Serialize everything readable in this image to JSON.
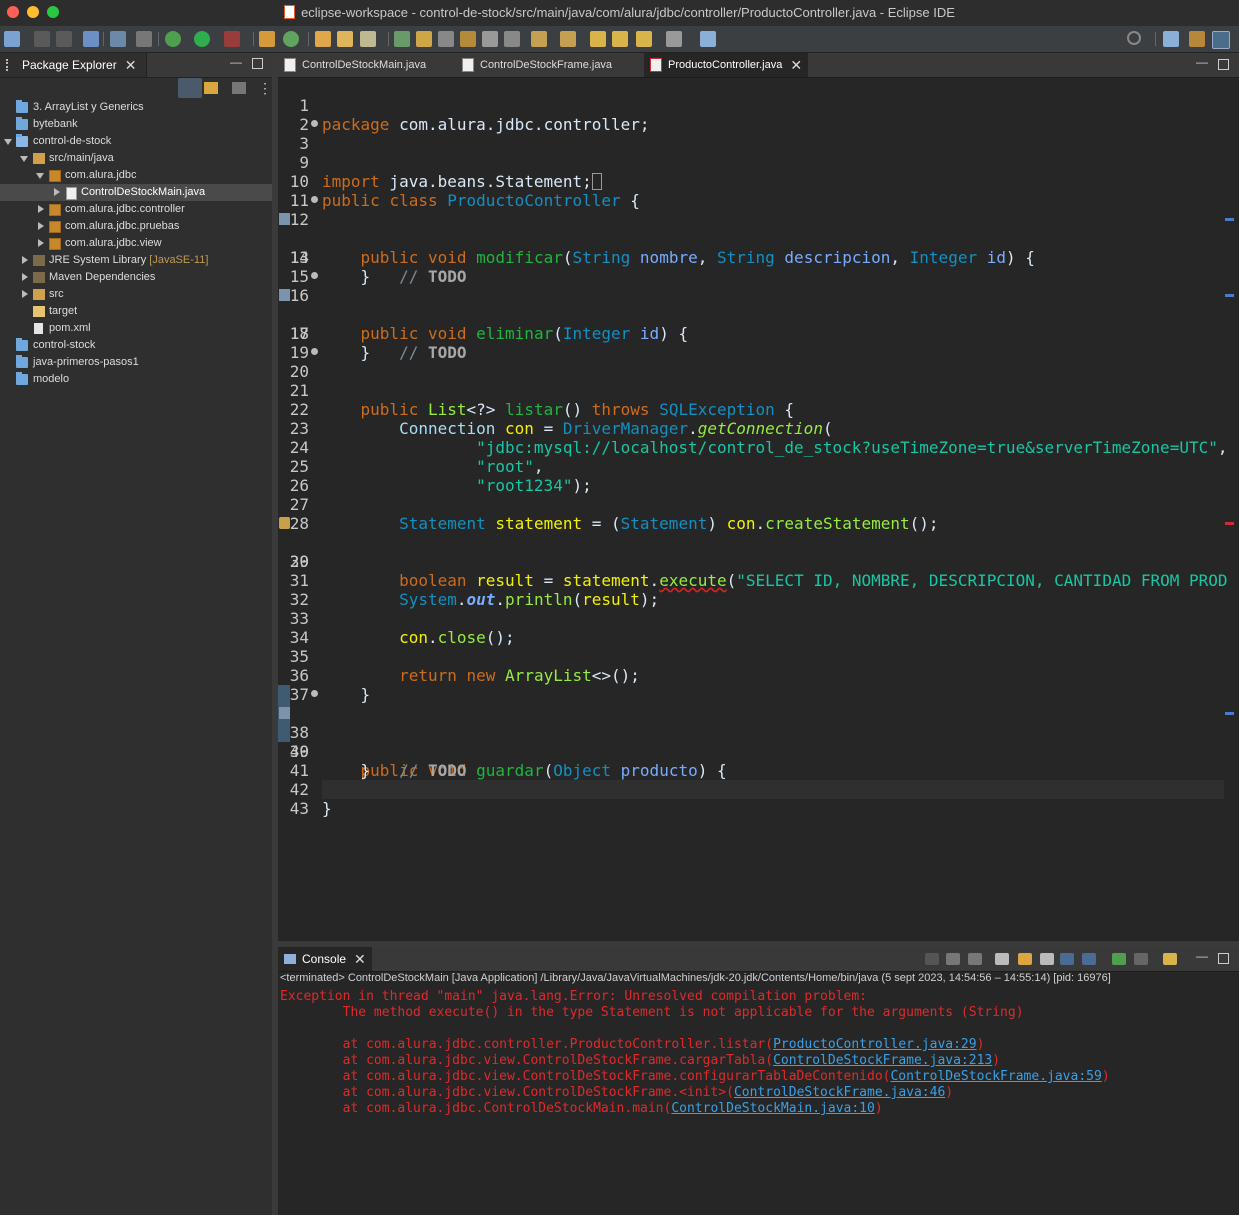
{
  "window": {
    "title": "eclipse-workspace - control-de-stock/src/main/java/com/alura/jdbc/controller/ProductoController.java - Eclipse IDE"
  },
  "package_explorer": {
    "tab_label": "Package Explorer",
    "items": [
      {
        "label": "3. ArrayList y Generics"
      },
      {
        "label": "bytebank"
      },
      {
        "label": "control-de-stock"
      },
      {
        "label": "src/main/java"
      },
      {
        "label": "com.alura.jdbc"
      },
      {
        "label": "ControlDeStockMain.java"
      },
      {
        "label": "com.alura.jdbc.controller"
      },
      {
        "label": "com.alura.jdbc.pruebas"
      },
      {
        "label": "com.alura.jdbc.view"
      },
      {
        "label": "JRE System Library",
        "suffix": "[JavaSE-11]"
      },
      {
        "label": "Maven Dependencies"
      },
      {
        "label": "src"
      },
      {
        "label": "target"
      },
      {
        "label": "pom.xml"
      },
      {
        "label": "control-stock"
      },
      {
        "label": "java-primeros-pasos1"
      },
      {
        "label": "modelo"
      }
    ]
  },
  "editor": {
    "tabs": [
      {
        "label": "ControlDeStockMain.java"
      },
      {
        "label": "ControlDeStockFrame.java"
      },
      {
        "label": "ProductoController.java"
      }
    ],
    "line_numbers": [
      "1",
      "2",
      "3",
      "9",
      "10",
      "11",
      "12",
      "13",
      "14",
      "15",
      "16",
      "17",
      "18",
      "19",
      "20",
      "21",
      "22",
      "23",
      "24",
      "25",
      "26",
      "27",
      "28",
      "29",
      "30",
      "31",
      "32",
      "33",
      "34",
      "35",
      "36",
      "37",
      "38",
      "39",
      "40",
      "41",
      "42",
      "43"
    ],
    "code": {
      "l1": [
        "package",
        " com.alura.jdbc.controller;"
      ],
      "l3": [
        "import",
        " java.beans.Statement;"
      ],
      "l10": [
        "public",
        "class",
        "ProductoController",
        " {"
      ],
      "l12": [
        "public",
        "void",
        "modificar",
        "(",
        "String",
        "nombre",
        ", ",
        "String",
        "descripcion",
        ", ",
        "Integer",
        "id",
        ") {"
      ],
      "l13": [
        "// ",
        "TODO"
      ],
      "l14": [
        "}"
      ],
      "l16": [
        "public",
        "void",
        "eliminar",
        "(",
        "Integer",
        "id",
        ") {"
      ],
      "l17": [
        "// ",
        "TODO"
      ],
      "l18": [
        "}"
      ],
      "l20": [
        "public",
        "List",
        "<?>",
        "listar",
        "() ",
        "throws",
        "SQLException",
        " {"
      ],
      "l22": [
        "Connection",
        "con",
        " = ",
        "DriverManager",
        ".",
        "getConnection",
        "("
      ],
      "l23": [
        "\"jdbc:mysql://localhost/control_de_stock?useTimeZone=true&serverTimeZone=UTC\"",
        ","
      ],
      "l24": [
        "\"root\"",
        ","
      ],
      "l25": [
        "\"root1234\"",
        ");"
      ],
      "l27": [
        "Statement",
        "statement",
        " = (",
        "Statement",
        ") ",
        "con",
        ".",
        "createStatement",
        "();"
      ],
      "l29": [
        "boolean",
        "result",
        " = ",
        "statement",
        ".",
        "execute",
        "(",
        "\"SELECT ID, NOMBRE, DESCRIPCION, CANTIDAD FROM PROD"
      ],
      "l31": [
        "System",
        ".",
        "out",
        ".",
        "println",
        "(",
        "result",
        ");"
      ],
      "l33": [
        "con",
        ".",
        "close",
        "();"
      ],
      "l35": [
        "return",
        "new",
        "ArrayList",
        "<>();"
      ],
      "l36": [
        "}"
      ],
      "l38": [
        "public",
        "void",
        "guardar",
        "(",
        "Object",
        "producto",
        ") {"
      ],
      "l39": [
        "// ",
        "TODO"
      ],
      "l40": [
        "}"
      ],
      "l42": [
        "}"
      ]
    }
  },
  "console": {
    "tab_label": "Console",
    "info": "<terminated> ControlDeStockMain [Java Application] /Library/Java/JavaVirtualMachines/jdk-20.jdk/Contents/Home/bin/java  (5 sept 2023, 14:54:56 – 14:55:14) [pid: 16976]",
    "lines": [
      {
        "text": "Exception in thread \"main\" java.lang.Error: Unresolved compilation problem: "
      },
      {
        "text": "\tThe method execute() in the type Statement is not applicable for the arguments (String)"
      },
      {
        "text": ""
      },
      {
        "text": "\tat com.alura.jdbc.controller.ProductoController.listar(",
        "link": "ProductoController.java:29",
        "end": ")"
      },
      {
        "text": "\tat com.alura.jdbc.view.ControlDeStockFrame.cargarTabla(",
        "link": "ControlDeStockFrame.java:213",
        "end": ")"
      },
      {
        "text": "\tat com.alura.jdbc.view.ControlDeStockFrame.configurarTablaDeContenido(",
        "link": "ControlDeStockFrame.java:59",
        "end": ")"
      },
      {
        "text": "\tat com.alura.jdbc.view.ControlDeStockFrame.<init>(",
        "link": "ControlDeStockFrame.java:46",
        "end": ")"
      },
      {
        "text": "\tat com.alura.jdbc.ControlDeStockMain.main(",
        "link": "ControlDeStockMain.java:10",
        "end": ")"
      }
    ]
  },
  "colors": {
    "keyword": "#cc6c1d",
    "type": "#1290c3",
    "class_name": "#1eb540",
    "string": "#17c6a3",
    "error": "#e02a2a",
    "link": "#3aa0e8"
  }
}
